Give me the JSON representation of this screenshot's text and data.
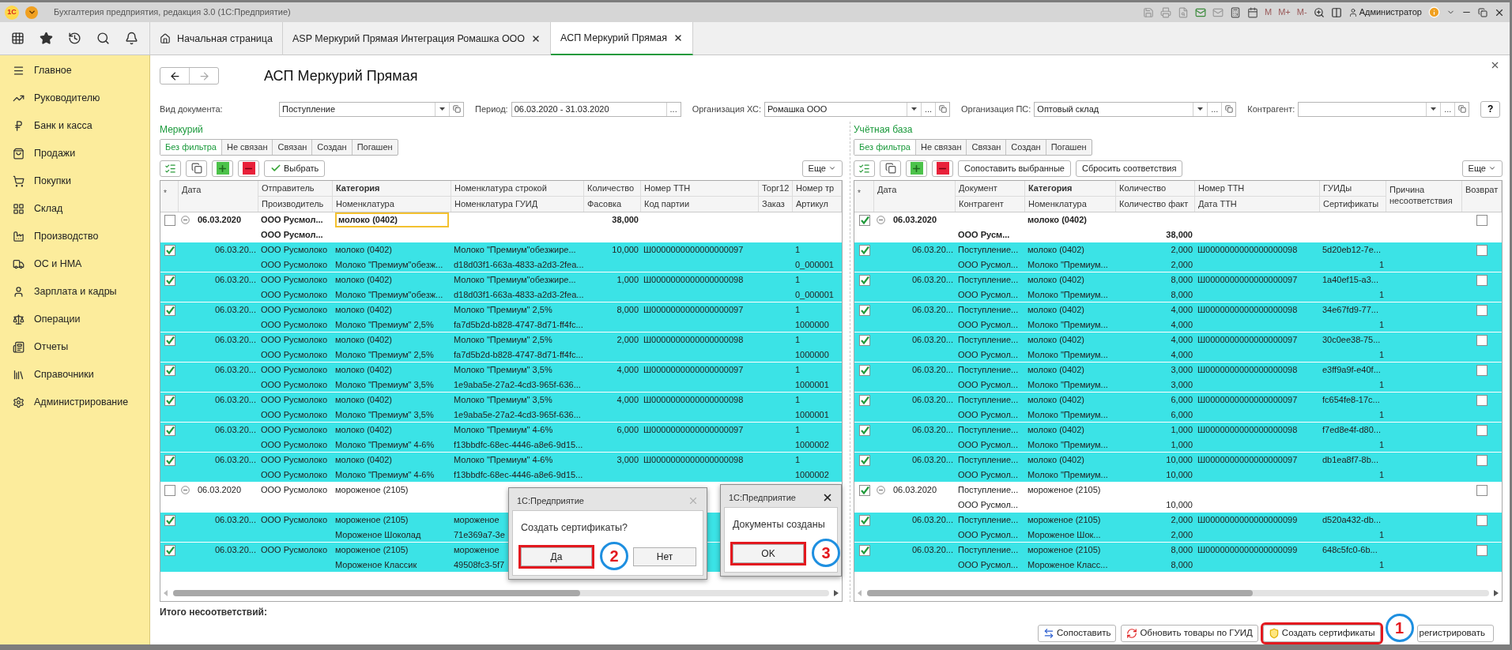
{
  "titlebar": {
    "logo": "1С",
    "title": "Бухгалтерия предприятия, редакция 3.0  (1С:Предприятие)",
    "memory_buttons": [
      "M",
      "M+",
      "M-"
    ],
    "user": "Администратор"
  },
  "tabs": [
    {
      "label": "Начальная страница",
      "kind": "home",
      "selected": false
    },
    {
      "label": "ASP Меркурий Прямая Интеграция Ромашка ООО",
      "kind": "document",
      "selected": false
    },
    {
      "label": "АСП Меркурий Прямая",
      "kind": "document",
      "selected": true
    }
  ],
  "sidebar": {
    "items": [
      {
        "label": "Главное"
      },
      {
        "label": "Руководителю"
      },
      {
        "label": "Банк и касса"
      },
      {
        "label": "Продажи"
      },
      {
        "label": "Покупки"
      },
      {
        "label": "Склад"
      },
      {
        "label": "Производство"
      },
      {
        "label": "ОС и НМА"
      },
      {
        "label": "Зарплата и кадры"
      },
      {
        "label": "Операции"
      },
      {
        "label": "Отчеты"
      },
      {
        "label": "Справочники"
      },
      {
        "label": "Администрирование"
      }
    ]
  },
  "form": {
    "title": "АСП Меркурий Прямая",
    "filters": [
      {
        "label": "Вид документа:",
        "value": "Поступление",
        "dropdown": true,
        "open_link": true
      },
      {
        "label": "Период:",
        "value": "06.03.2020 - 31.03.2020",
        "select_button": "...",
        "dropdown": false,
        "open_link": false
      },
      {
        "label": "Организация ХС:",
        "value": "Ромашка ООО",
        "select_button": "...",
        "dropdown": true,
        "open_link": true
      },
      {
        "label": "Организация ПС:",
        "value": "Оптовый склад",
        "select_button": "...",
        "dropdown": true,
        "open_link": true
      },
      {
        "label": "Контрагент:",
        "select_button": "...",
        "dropdown": true,
        "open_link": true
      }
    ],
    "help": "?"
  },
  "left_panel": {
    "title": "Меркурий",
    "filter_tabs": [
      {
        "label": "Без фильтра",
        "selected": true
      },
      {
        "label": "Не связан",
        "selected": false
      },
      {
        "label": "Связан",
        "selected": false
      },
      {
        "label": "Создан",
        "selected": false
      },
      {
        "label": "Погашен",
        "selected": false
      }
    ],
    "buttons": [
      "Выбрать"
    ],
    "more": "Еще",
    "table": {
      "mark_header": "*",
      "columns": [
        {
          "top": "Дата"
        },
        {
          "top": "Отправитель",
          "bottom": "Производитель"
        },
        {
          "top": "Категория",
          "bottom": "Номенклатура",
          "bold": true
        },
        {
          "top": "Номенклатура строкой",
          "bottom": "Номенклатура ГУИД"
        },
        {
          "top": "Количество",
          "bottom": "Фасовка"
        },
        {
          "top": "Номер ТТН",
          "bottom": "Код партии"
        },
        {
          "top": "Торг12",
          "bottom": "Заказ"
        },
        {
          "top": "Номер тр",
          "bottom": "Артикул"
        }
      ],
      "rows": [
        {
          "kind": "group",
          "checked": false,
          "expanded": true,
          "bold": true,
          "focused": true,
          "cells": [
            [
              "06.03.2020"
            ],
            [
              "ООО Русмол...",
              "ООО Русмол..."
            ],
            [
              "молоко (0402)"
            ],
            null,
            [
              "38,000"
            ]
          ]
        },
        {
          "kind": "item",
          "checked": true,
          "cells": [
            [
              "06.03.20..."
            ],
            [
              "ООО Русмолоко",
              "ООО Русмолоко"
            ],
            [
              "молоко (0402)",
              "Молоко \"Премиум\"обезж..."
            ],
            [
              "Молоко \"Премиум\"обезжире...",
              "d18d03f1-663a-4833-a2d3-2fea..."
            ],
            [
              "10,000"
            ],
            [
              "Ш0000000000000000097"
            ],
            null,
            [
              "1",
              "0_000001"
            ]
          ]
        },
        {
          "kind": "item",
          "checked": true,
          "cells": [
            [
              "06.03.20..."
            ],
            [
              "ООО Русмолоко",
              "ООО Русмолоко"
            ],
            [
              "молоко (0402)",
              "Молоко \"Премиум\"обезж..."
            ],
            [
              "Молоко \"Премиум\"обезжире...",
              "d18d03f1-663a-4833-a2d3-2fea..."
            ],
            [
              "1,000"
            ],
            [
              "Ш0000000000000000098"
            ],
            null,
            [
              "1",
              "0_000001"
            ]
          ]
        },
        {
          "kind": "item",
          "checked": true,
          "cells": [
            [
              "06.03.20..."
            ],
            [
              "ООО Русмолоко",
              "ООО Русмолоко"
            ],
            [
              "молоко (0402)",
              "Молоко \"Премиум\" 2,5%"
            ],
            [
              "Молоко \"Премиум\" 2,5%",
              "fa7d5b2d-b828-4747-8d71-ff4fc..."
            ],
            [
              "8,000"
            ],
            [
              "Ш0000000000000000097"
            ],
            null,
            [
              "1",
              "1000000"
            ]
          ]
        },
        {
          "kind": "item",
          "checked": true,
          "cells": [
            [
              "06.03.20..."
            ],
            [
              "ООО Русмолоко",
              "ООО Русмолоко"
            ],
            [
              "молоко (0402)",
              "Молоко \"Премиум\" 2,5%"
            ],
            [
              "Молоко \"Премиум\" 2,5%",
              "fa7d5b2d-b828-4747-8d71-ff4fc..."
            ],
            [
              "2,000"
            ],
            [
              "Ш0000000000000000098"
            ],
            null,
            [
              "1",
              "1000000"
            ]
          ]
        },
        {
          "kind": "item",
          "checked": true,
          "cells": [
            [
              "06.03.20..."
            ],
            [
              "ООО Русмолоко",
              "ООО Русмолоко"
            ],
            [
              "молоко (0402)",
              "Молоко \"Премиум\" 3,5%"
            ],
            [
              "Молоко \"Премиум\" 3,5%",
              "1e9aba5e-27a2-4cd3-965f-636..."
            ],
            [
              "4,000"
            ],
            [
              "Ш0000000000000000097"
            ],
            null,
            [
              "1",
              "1000001"
            ]
          ]
        },
        {
          "kind": "item",
          "checked": true,
          "cells": [
            [
              "06.03.20..."
            ],
            [
              "ООО Русмолоко",
              "ООО Русмолоко"
            ],
            [
              "молоко (0402)",
              "Молоко \"Премиум\" 3,5%"
            ],
            [
              "Молоко \"Премиум\" 3,5%",
              "1e9aba5e-27a2-4cd3-965f-636..."
            ],
            [
              "4,000"
            ],
            [
              "Ш0000000000000000098"
            ],
            null,
            [
              "1",
              "1000001"
            ]
          ]
        },
        {
          "kind": "item",
          "checked": true,
          "cells": [
            [
              "06.03.20..."
            ],
            [
              "ООО Русмолоко",
              "ООО Русмолоко"
            ],
            [
              "молоко (0402)",
              "Молоко \"Премиум\" 4-6%"
            ],
            [
              "Молоко \"Премиум\" 4-6%",
              "f13bbdfc-68ec-4446-a8e6-9d15..."
            ],
            [
              "6,000"
            ],
            [
              "Ш0000000000000000097"
            ],
            null,
            [
              "1",
              "1000002"
            ]
          ]
        },
        {
          "kind": "item",
          "checked": true,
          "cells": [
            [
              "06.03.20..."
            ],
            [
              "ООО Русмолоко",
              "ООО Русмолоко"
            ],
            [
              "молоко (0402)",
              "Молоко \"Премиум\" 4-6%"
            ],
            [
              "Молоко \"Премиум\" 4-6%",
              "f13bbdfc-68ec-4446-a8e6-9d15..."
            ],
            [
              "3,000"
            ],
            [
              "Ш0000000000000000098"
            ],
            null,
            [
              "1",
              "1000002"
            ]
          ]
        },
        {
          "kind": "group",
          "checked": false,
          "expanded": true,
          "bold": false,
          "focused": false,
          "cells": [
            [
              "06.03.2020"
            ],
            [
              "ООО Русмолоко"
            ],
            [
              "мороженое (2105)"
            ]
          ]
        },
        {
          "kind": "item",
          "checked": true,
          "cells": [
            [
              "06.03.20..."
            ],
            [
              "ООО Русмолоко"
            ],
            [
              "мороженое (2105)",
              "Мороженое Шоколад"
            ],
            [
              "мороженое",
              "71e369a7-3e"
            ]
          ]
        },
        {
          "kind": "item",
          "checked": true,
          "cells": [
            [
              "06.03.20..."
            ],
            [
              "ООО Русмолоко"
            ],
            [
              "мороженое (2105)",
              "Мороженое Классик"
            ],
            [
              "мороженое",
              "49508fc3-5f7"
            ]
          ]
        }
      ]
    }
  },
  "right_panel": {
    "title": "Учётная база",
    "filter_tabs": [
      {
        "label": "Без фильтра",
        "selected": true
      },
      {
        "label": "Не связан",
        "selected": false
      },
      {
        "label": "Связан",
        "selected": false
      },
      {
        "label": "Создан",
        "selected": false
      },
      {
        "label": "Погашен",
        "selected": false
      }
    ],
    "buttons": [
      "Сопоставить выбранные",
      "Сбросить соответствия"
    ],
    "more": "Еще",
    "table": {
      "mark_header": "*",
      "columns": [
        {
          "top": "Дата",
          "kind": "text"
        },
        {
          "top": "Документ",
          "bottom": "Контрагент",
          "kind": "text"
        },
        {
          "top": "Категория",
          "bottom": "Номенклатура",
          "bold": true,
          "kind": "text"
        },
        {
          "top": "Количество",
          "bottom": "Количество факт",
          "kind": "text"
        },
        {
          "top": "Номер ТТН",
          "bottom": "Дата ТТН",
          "kind": "text"
        },
        {
          "top": "ГУИДы",
          "bottom": "Сертификаты",
          "kind": "text"
        },
        {
          "top": "Причина несоответствия",
          "kind": "text"
        },
        {
          "top": "Возврат",
          "kind": "checkbox"
        }
      ],
      "rows": [
        {
          "kind": "group",
          "checked": true,
          "expanded": true,
          "bold": true,
          "returned": false,
          "cells": [
            [
              "06.03.2020"
            ],
            [
              null,
              "ООО Русм..."
            ],
            [
              "молоко (0402)"
            ],
            [
              null,
              "38,000"
            ]
          ]
        },
        {
          "kind": "item",
          "checked": true,
          "returned": false,
          "cells": [
            [
              "06.03.20..."
            ],
            [
              "Поступление...",
              "ООО Русмол..."
            ],
            [
              "молоко (0402)",
              "Молоко \"Премиум..."
            ],
            [
              "2,000",
              "2,000"
            ],
            [
              "Ш0000000000000000098"
            ],
            [
              "5d20eb12-7e...",
              "1"
            ]
          ]
        },
        {
          "kind": "item",
          "checked": true,
          "returned": false,
          "cells": [
            [
              "06.03.20..."
            ],
            [
              "Поступление...",
              "ООО Русмол..."
            ],
            [
              "молоко (0402)",
              "Молоко \"Премиум..."
            ],
            [
              "8,000",
              "8,000"
            ],
            [
              "Ш0000000000000000097"
            ],
            [
              "1a40ef15-a3...",
              "1"
            ]
          ]
        },
        {
          "kind": "item",
          "checked": true,
          "returned": false,
          "cells": [
            [
              "06.03.20..."
            ],
            [
              "Поступление...",
              "ООО Русмол..."
            ],
            [
              "молоко (0402)",
              "Молоко \"Премиум..."
            ],
            [
              "4,000",
              "4,000"
            ],
            [
              "Ш0000000000000000098"
            ],
            [
              "34e67fd9-77...",
              "1"
            ]
          ]
        },
        {
          "kind": "item",
          "checked": true,
          "returned": false,
          "cells": [
            [
              "06.03.20..."
            ],
            [
              "Поступление...",
              "ООО Русмол..."
            ],
            [
              "молоко (0402)",
              "Молоко \"Премиум..."
            ],
            [
              "4,000",
              "4,000"
            ],
            [
              "Ш0000000000000000097"
            ],
            [
              "30c0ee38-75...",
              "1"
            ]
          ]
        },
        {
          "kind": "item",
          "checked": true,
          "returned": false,
          "cells": [
            [
              "06.03.20..."
            ],
            [
              "Поступление...",
              "ООО Русмол..."
            ],
            [
              "молоко (0402)",
              "Молоко \"Премиум..."
            ],
            [
              "3,000",
              "3,000"
            ],
            [
              "Ш0000000000000000098"
            ],
            [
              "e3ff9a9f-e40f...",
              "1"
            ]
          ]
        },
        {
          "kind": "item",
          "checked": true,
          "returned": false,
          "cells": [
            [
              "06.03.20..."
            ],
            [
              "Поступление...",
              "ООО Русмол..."
            ],
            [
              "молоко (0402)",
              "Молоко \"Премиум..."
            ],
            [
              "6,000",
              "6,000"
            ],
            [
              "Ш0000000000000000097"
            ],
            [
              "fc654fe8-17c...",
              "1"
            ]
          ]
        },
        {
          "kind": "item",
          "checked": true,
          "returned": false,
          "cells": [
            [
              "06.03.20..."
            ],
            [
              "Поступление...",
              "ООО Русмол..."
            ],
            [
              "молоко (0402)",
              "Молоко \"Премиум..."
            ],
            [
              "1,000",
              "1,000"
            ],
            [
              "Ш0000000000000000098"
            ],
            [
              "f7ed8e4f-d80...",
              "1"
            ]
          ]
        },
        {
          "kind": "item",
          "checked": true,
          "returned": false,
          "cells": [
            [
              "06.03.20..."
            ],
            [
              "Поступление...",
              "ООО Русмол..."
            ],
            [
              "молоко (0402)",
              "Молоко \"Премиум..."
            ],
            [
              "10,000",
              "10,000"
            ],
            [
              "Ш0000000000000000097"
            ],
            [
              "db1ea8f7-8b...",
              "1"
            ]
          ]
        },
        {
          "kind": "group",
          "checked": true,
          "expanded": true,
          "bold": false,
          "returned": false,
          "cells": [
            [
              "06.03.2020"
            ],
            [
              "Поступление...",
              "ООО Русмол..."
            ],
            [
              "мороженое (2105)"
            ],
            [
              null,
              "10,000"
            ]
          ]
        },
        {
          "kind": "item",
          "checked": true,
          "returned": false,
          "cells": [
            [
              "06.03.20..."
            ],
            [
              "Поступление...",
              "ООО Русмол..."
            ],
            [
              "мороженое (2105)",
              "Мороженое Шок..."
            ],
            [
              "2,000",
              "2,000"
            ],
            [
              "Ш0000000000000000099"
            ],
            [
              "d520a432-db...",
              "1"
            ]
          ]
        },
        {
          "kind": "item",
          "checked": true,
          "returned": false,
          "cells": [
            [
              "06.03.20..."
            ],
            [
              "Поступление...",
              "ООО Русмол..."
            ],
            [
              "мороженое (2105)",
              "Мороженое Класс..."
            ],
            [
              "8,000",
              "8,000"
            ],
            [
              "Ш0000000000000000099"
            ],
            [
              "648c5fc0-6b...",
              "1"
            ]
          ]
        }
      ]
    }
  },
  "summary_label": "Итого несоответствий:",
  "actions": [
    {
      "label": "Сопоставить",
      "kind": "match",
      "highlighted": false
    },
    {
      "label": "Обновить товары по ГУИД",
      "kind": "refresh",
      "highlighted": false
    },
    {
      "label": "Создать сертификаты",
      "kind": "certificate",
      "highlighted": true,
      "callout": "1"
    },
    {
      "label": "регистрировать",
      "kind": "register",
      "highlighted": false
    }
  ],
  "dialogs": [
    {
      "title": "1С:Предприятие",
      "active": false,
      "message": "Создать сертификаты?",
      "buttons": [
        {
          "label": "Да",
          "highlighted": true,
          "callout": "2"
        },
        {
          "label": "Нет",
          "highlighted": false
        }
      ]
    },
    {
      "title": "1С:Предприятие",
      "active": true,
      "message": "Документы созданы",
      "buttons": [
        {
          "label": "OK",
          "highlighted": true,
          "callout": "3"
        }
      ]
    }
  ]
}
